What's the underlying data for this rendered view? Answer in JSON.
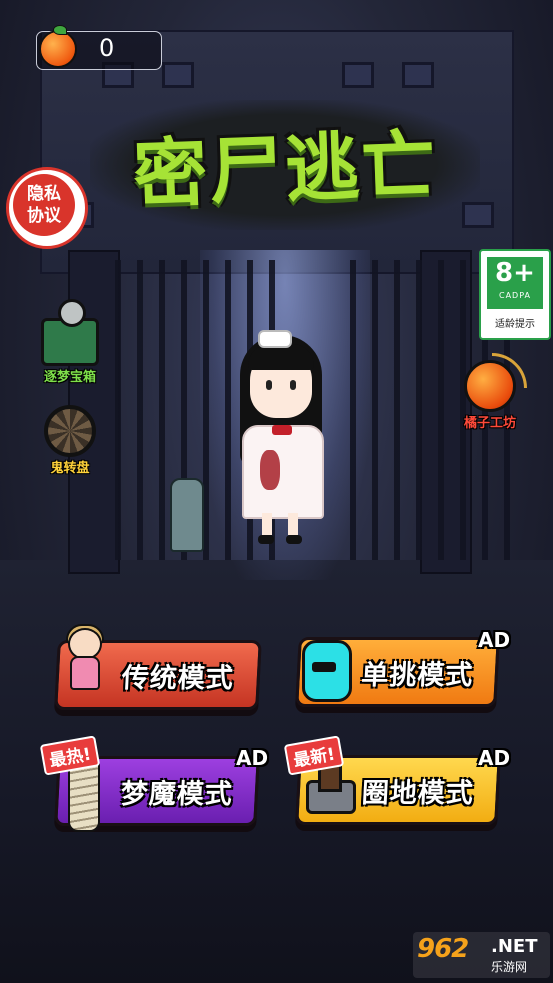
{
  "header": {
    "currency_icon": "orange-icon",
    "currency_count": "0"
  },
  "title": {
    "text": "密尸逃亡",
    "color": "#a6e336"
  },
  "privacy": {
    "line1": "隐私",
    "line2": "协议",
    "color": "#d9342b"
  },
  "age_rating": {
    "rating": "8+",
    "org": "CADPA",
    "hint": "适龄提示",
    "color": "#2aa04a"
  },
  "side_left": [
    {
      "label": "逐梦宝箱",
      "icon": "treasure-chest-icon",
      "color": "#7ee04a"
    },
    {
      "label": "鬼转盘",
      "icon": "ghost-wheel-icon",
      "color": "#ffd23a"
    }
  ],
  "side_right": [
    {
      "label": "橘子工坊",
      "icon": "tangerine-workshop-icon",
      "color": "#ff4a3a"
    }
  ],
  "modes": {
    "traditional": {
      "label": "传统模式",
      "icon": "doll-icon"
    },
    "single": {
      "label": "单挑模式",
      "icon": "blue-monster-icon",
      "ad": "AD"
    },
    "nightmare": {
      "label": "梦魔模式",
      "icon": "mummy-icon",
      "ad": "AD",
      "tag": "最热!"
    },
    "territory": {
      "label": "圈地模式",
      "icon": "tower-icon",
      "ad": "AD",
      "tag": "最新!"
    }
  },
  "watermark": {
    "brand": "962",
    "net": ".NET",
    "sub": "乐游网"
  }
}
